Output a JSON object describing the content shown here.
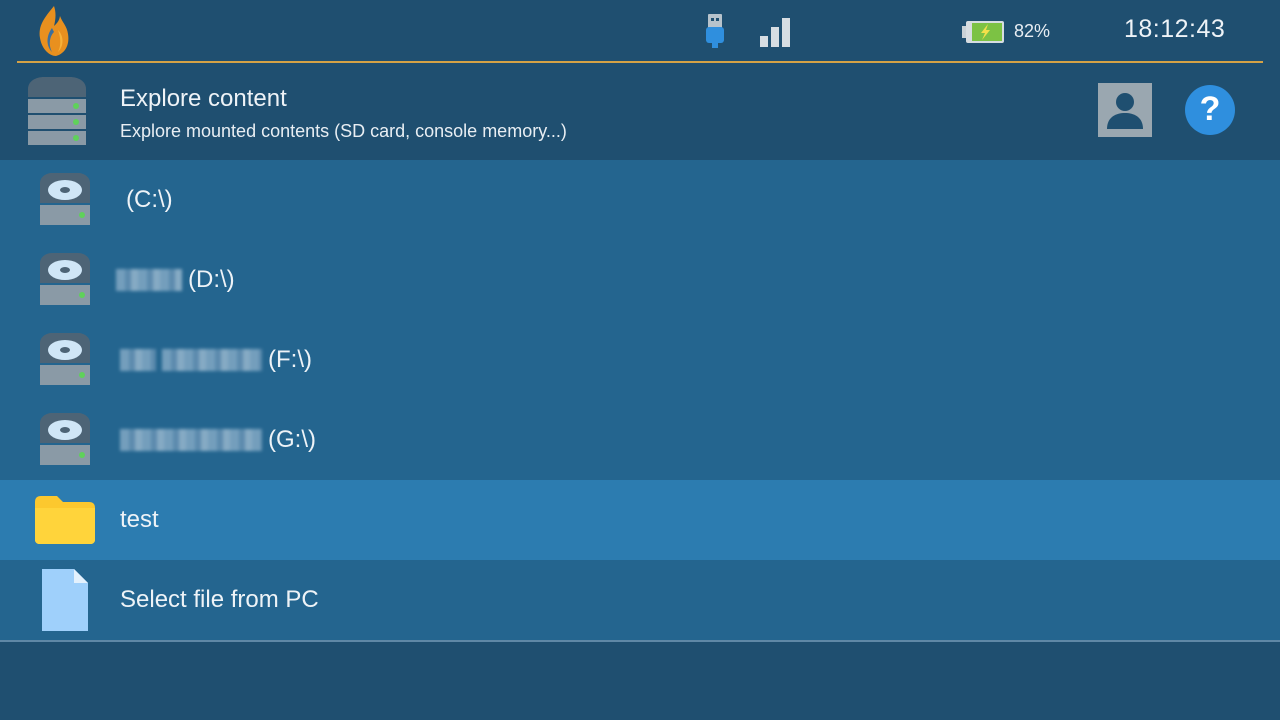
{
  "status": {
    "battery_percent": "82%",
    "battery_level": 0.82,
    "time": "18:12:43",
    "icons": [
      "app-logo-flame",
      "usb-icon",
      "signal-icon",
      "battery-charging-icon"
    ]
  },
  "header": {
    "title": "Explore content",
    "subtitle": "Explore mounted contents (SD card, console memory...)",
    "icon": "server-icon",
    "help_label": "?"
  },
  "list": {
    "items": [
      {
        "label": "(C:\\)",
        "icon": "disk-drive-icon"
      },
      {
        "label": "(D:\\)",
        "icon": "disk-drive-icon"
      },
      {
        "label": "(F:\\)",
        "icon": "disk-drive-icon"
      },
      {
        "label": "(G:\\)",
        "icon": "disk-drive-icon"
      },
      {
        "label": "test",
        "icon": "folder-icon"
      },
      {
        "label": "Select file from PC",
        "icon": "file-icon"
      }
    ]
  },
  "colors": {
    "background": "#1f4f70",
    "list_background": "#24658f",
    "selected_row": "#2c7cb0",
    "accent_line": "#d4a246",
    "help_button": "#2f8fde"
  }
}
